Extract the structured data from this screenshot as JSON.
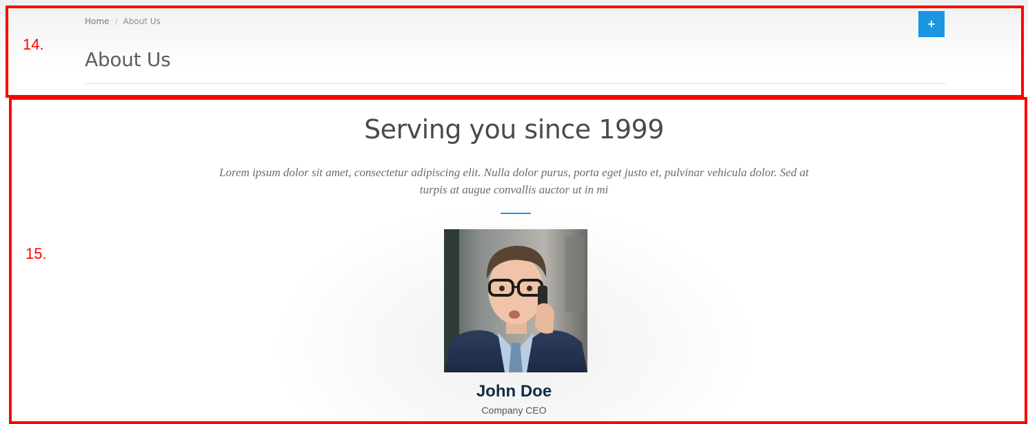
{
  "header": {
    "breadcrumb": [
      "Home",
      "About Us"
    ],
    "title": "About Us",
    "action_label": "+"
  },
  "annotations": {
    "header_label": "14.",
    "content_label": "15."
  },
  "content": {
    "title": "Serving you since 1999",
    "lead": "Lorem ipsum dolor sit amet, consectetur adipiscing elit. Nulla dolor purus, porta eget justo et, pulvinar vehicula dolor. Sed at turpis at augue convallis auctor ut in mi",
    "team_member": {
      "name": "John Doe",
      "role": "Company CEO"
    }
  },
  "colors": {
    "accent": "#1a96e0",
    "annotation": "#ff0000",
    "name": "#0d2b45"
  },
  "icons": {
    "action": "plus-icon"
  }
}
